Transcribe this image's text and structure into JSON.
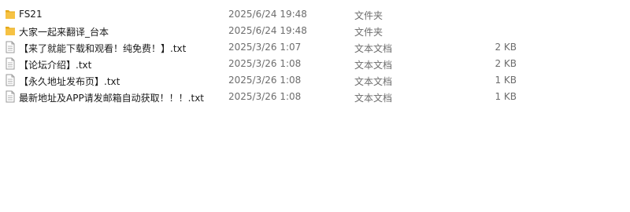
{
  "colors": {
    "folder_body": "#f6c244",
    "folder_tab": "#e5a91a",
    "doc_border": "#9a9a9a",
    "doc_lines": "#b4b4b4"
  },
  "files": [
    {
      "name": "FS21",
      "date": "2025/6/24 19:48",
      "type": "文件夹",
      "size": "",
      "icon": "folder-icon"
    },
    {
      "name": "大家一起来翻译_台本",
      "date": "2025/6/24 19:48",
      "type": "文件夹",
      "size": "",
      "icon": "folder-icon"
    },
    {
      "name": "【来了就能下载和观看！纯免费！】.txt",
      "date": "2025/3/26 1:07",
      "type": "文本文档",
      "size": "2 KB",
      "icon": "text-file-icon"
    },
    {
      "name": "【论坛介绍】.txt",
      "date": "2025/3/26 1:08",
      "type": "文本文档",
      "size": "2 KB",
      "icon": "text-file-icon"
    },
    {
      "name": "【永久地址发布页】.txt",
      "date": "2025/3/26 1:08",
      "type": "文本文档",
      "size": "1 KB",
      "icon": "text-file-icon"
    },
    {
      "name": "最新地址及APP请发邮箱自动获取！！！.txt",
      "date": "2025/3/26 1:08",
      "type": "文本文档",
      "size": "1 KB",
      "icon": "text-file-icon"
    }
  ]
}
